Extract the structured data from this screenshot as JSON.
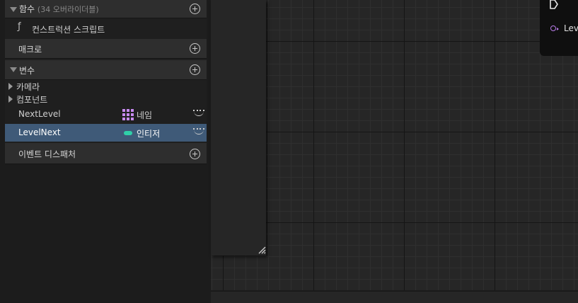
{
  "panel": {
    "functions": {
      "title": "함수",
      "subtitle": "(34 오버라이더블)"
    },
    "construction_script": "컨스트럭션 스크립트",
    "macros": {
      "title": "매크로"
    },
    "variables": {
      "title": "변수",
      "categories": [
        "카메라",
        "컴포넌트"
      ],
      "items": [
        {
          "name": "NextLevel",
          "type": "네임",
          "type_color": "#c78af0",
          "selected": false
        },
        {
          "name": "LevelNext",
          "type": "인티저",
          "type_color": "#30d0a8",
          "selected": true
        }
      ]
    },
    "event_dispatchers": {
      "title": "이벤트 디스패처"
    },
    "colors": {
      "selection": "#3f5a78",
      "panel_bg": "#1f1f1f",
      "header_bg": "#2e2e2e"
    }
  },
  "graph": {
    "node_pin_label": "Leve"
  }
}
